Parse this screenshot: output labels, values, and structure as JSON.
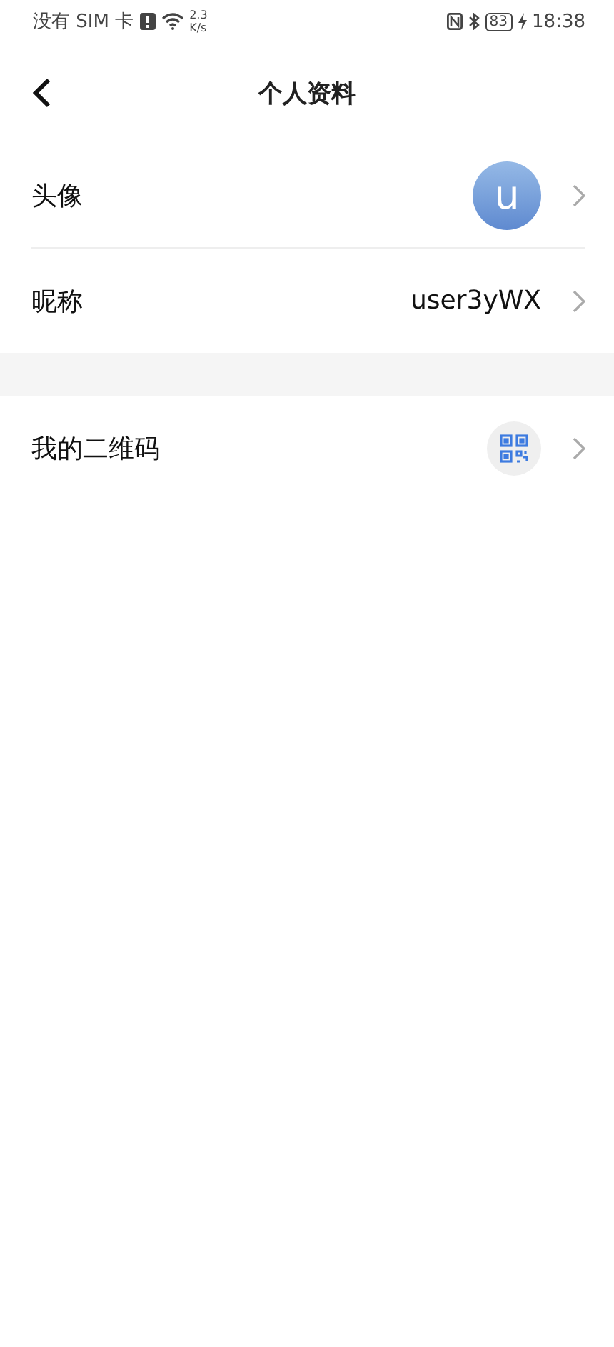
{
  "status_bar": {
    "carrier": "没有 SIM 卡",
    "speed_value": "2.3",
    "speed_unit": "K/s",
    "battery": "83",
    "time": "18:38"
  },
  "header": {
    "title": "个人资料"
  },
  "sections": [
    {
      "rows": [
        {
          "kind": "avatar",
          "label": "头像",
          "value": "u"
        },
        {
          "kind": "text",
          "label": "昵称",
          "value": "user3yWX"
        }
      ]
    },
    {
      "rows": [
        {
          "kind": "qr",
          "label": "我的二维码"
        }
      ]
    }
  ]
}
